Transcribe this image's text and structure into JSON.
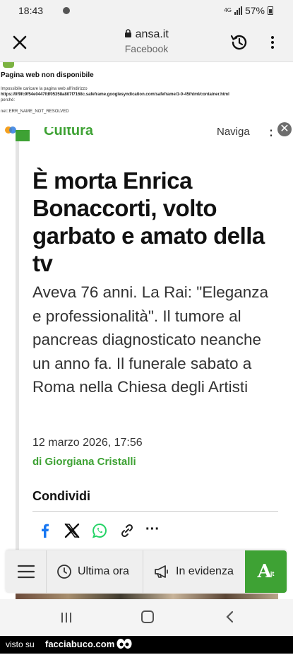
{
  "status_bar": {
    "time": "18:43",
    "network": "4G",
    "battery": "57%"
  },
  "browser": {
    "domain": "ansa.it",
    "source": "Facebook"
  },
  "ad_error": {
    "title": "Pagina web non disponibile",
    "description": "Impossibile caricare la pagina web all'indirizzo",
    "url": "https://0f9fc9f54e0447fdf05358a807f7168c.safeframe.googlesyndication.com/safeframe/1-0-45/html/container.html",
    "why": "perché:",
    "error_code": "net::ERR_NAME_NOT_RESOLVED"
  },
  "category": {
    "label": "Cultura",
    "naviga": "Naviga",
    "dots": "⋮"
  },
  "article": {
    "headline": "È morta Enrica Bonaccorti, volto garbato e amato della tv",
    "subtitle": "Aveva 76 anni. La Rai: \"Eleganza e professionalità\". Il tumore al pancreas diagnosticato neanche un anno fa. Il funerale sabato a Roma nella Chiesa degli Artisti",
    "date": "12 marzo 2026, 17:56",
    "author": "di Giorgiana Cristalli"
  },
  "share": {
    "label": "Condividi",
    "more": "···"
  },
  "bottom_nav": {
    "ultima_ora": "Ultima ora",
    "in_evidenza": "In evidenza",
    "logo_letter": "A",
    "logo_suffix": "it"
  },
  "footer": {
    "prefix": "visto su",
    "site": "facciabuco.com"
  },
  "colors": {
    "accent": "#3ea234",
    "facebook": "#1877f2",
    "whatsapp": "#25d366"
  }
}
